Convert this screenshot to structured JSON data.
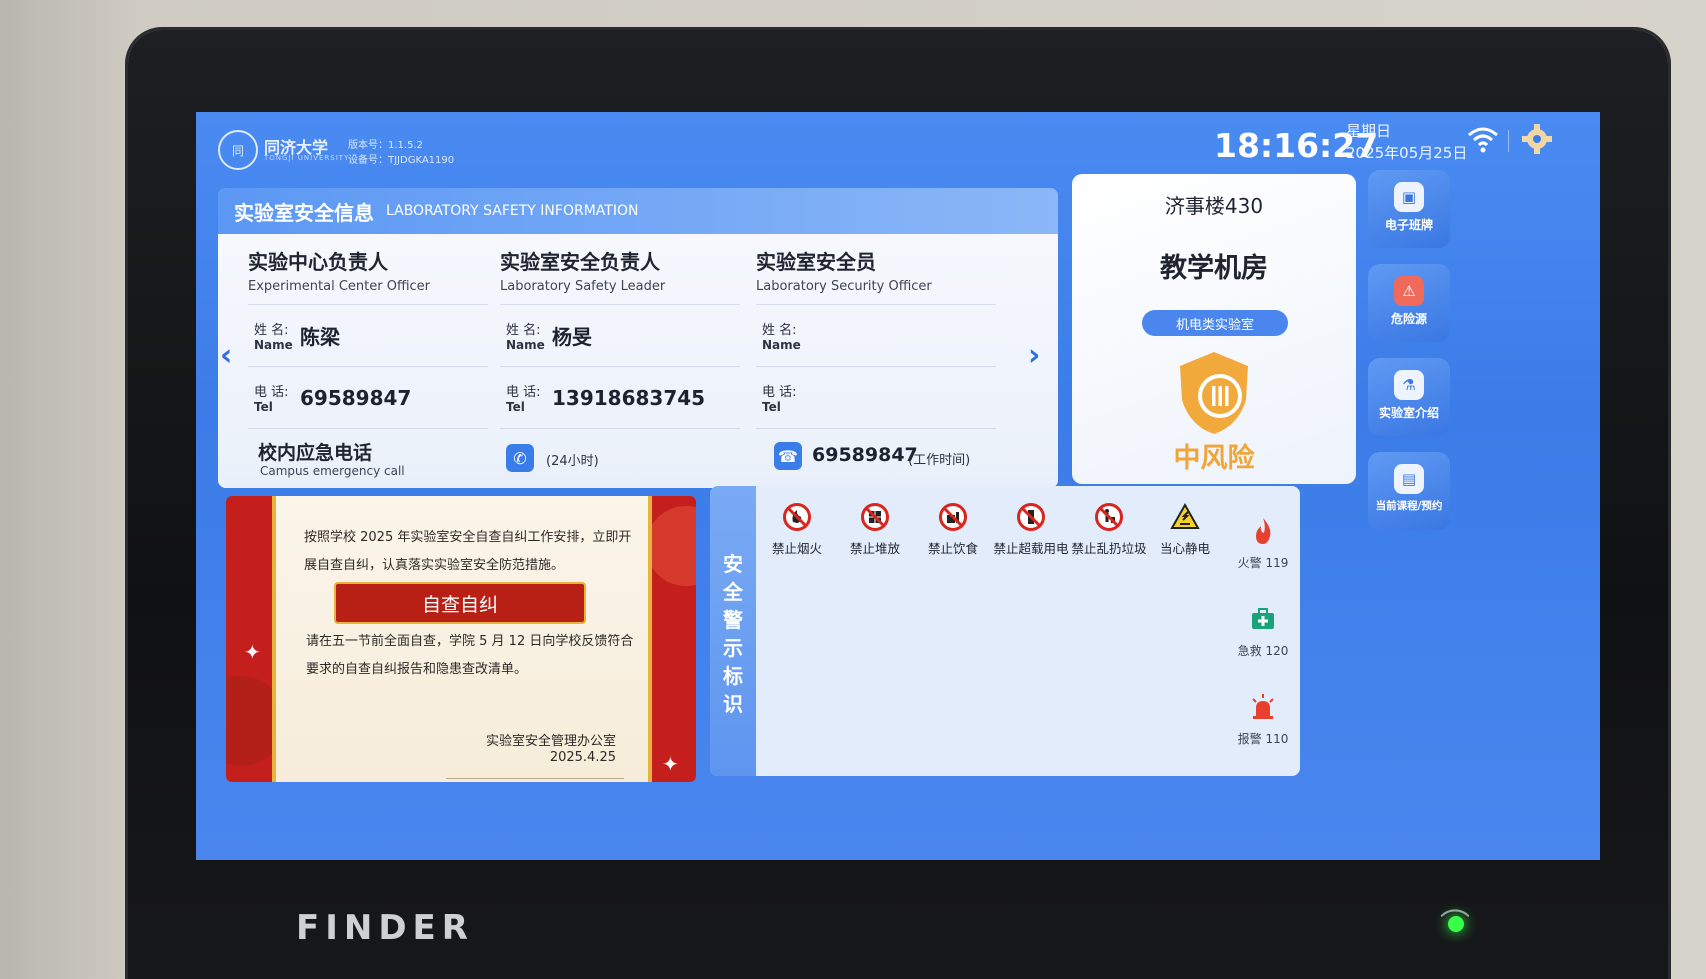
{
  "header": {
    "university_name": "同济大学",
    "university_sub": "TONGJI UNIVERSITY",
    "version": "版本号：1.1.5.2",
    "device_id": "设备号：TJJDGKA1190",
    "time": "18:16:27",
    "weekday": "星期日",
    "date": "2025年05月25日"
  },
  "safety_info": {
    "title_cn": "实验室安全信息",
    "title_en": "LABORATORY SAFETY INFORMATION",
    "contacts": [
      {
        "role_cn": "实验中心负责人",
        "role_en": "Experimental Center Officer",
        "name_label": "姓 名:",
        "name_label_en": "Name",
        "name": "陈梁",
        "tel_label": "电 话:",
        "tel_label_en": "Tel",
        "tel": "69589847"
      },
      {
        "role_cn": "实验室安全负责人",
        "role_en": "Laboratory Safety Leader",
        "name_label": "姓 名:",
        "name_label_en": "Name",
        "name": "杨旻",
        "tel_label": "电 话:",
        "tel_label_en": "Tel",
        "tel": "13918683745"
      },
      {
        "role_cn": "实验室安全员",
        "role_en": "Laboratory Security Officer",
        "name_label": "姓 名:",
        "name_label_en": "Name",
        "name": "",
        "tel_label": "电 话:",
        "tel_label_en": "Tel",
        "tel": ""
      }
    ],
    "emergency": {
      "title_cn": "校内应急电话",
      "title_en": "Campus emergency call",
      "note_24h": "(24小时)",
      "number": "69589847",
      "note_work": "(工作时间)"
    }
  },
  "room": {
    "number": "济事楼430",
    "name": "教学机房",
    "tag": "机电类实验室",
    "risk_level": "中风险"
  },
  "nav": [
    {
      "label": "电子班牌",
      "icon": "screen-icon"
    },
    {
      "label": "危险源",
      "icon": "warning-icon"
    },
    {
      "label": "实验室介绍",
      "icon": "flask-icon"
    },
    {
      "label": "当前课程/预约",
      "icon": "calendar-icon"
    }
  ],
  "notice": {
    "paragraph1": "按照学校 2025 年实验室安全自查自纠工作安排，立即开展自查自纠，认真落实实验室安全防范措施。",
    "button": "自查自纠",
    "paragraph2": "请在五一节前全面自查，学院 5 月 12 日向学校反馈符合要求的自查自纠报告和隐患查改清单。",
    "signature_org": "实验室安全管理办公室",
    "signature_date": "2025.4.25"
  },
  "warning_signs": {
    "title": "安全警示标识",
    "signs": [
      {
        "label": "禁止烟火",
        "icon": "no-fire-icon"
      },
      {
        "label": "禁止堆放",
        "icon": "no-stacking-icon"
      },
      {
        "label": "禁止饮食",
        "icon": "no-food-icon"
      },
      {
        "label": "禁止超载用电",
        "icon": "no-overload-icon"
      },
      {
        "label": "禁止乱扔垃圾",
        "icon": "no-litter-icon"
      },
      {
        "label": "当心静电",
        "icon": "static-warning-icon"
      }
    ],
    "phones": [
      {
        "label": "火警 119",
        "icon": "fire-icon"
      },
      {
        "label": "急救 120",
        "icon": "first-aid-icon"
      },
      {
        "label": "报警 110",
        "icon": "alarm-icon"
      }
    ]
  },
  "device": {
    "brand": "FINDER"
  },
  "colors": {
    "screen_blue": "#3b7ce8",
    "risk_orange": "#f0a53a",
    "notice_red": "#c41f1c",
    "prohibit_red": "#d8261f"
  }
}
